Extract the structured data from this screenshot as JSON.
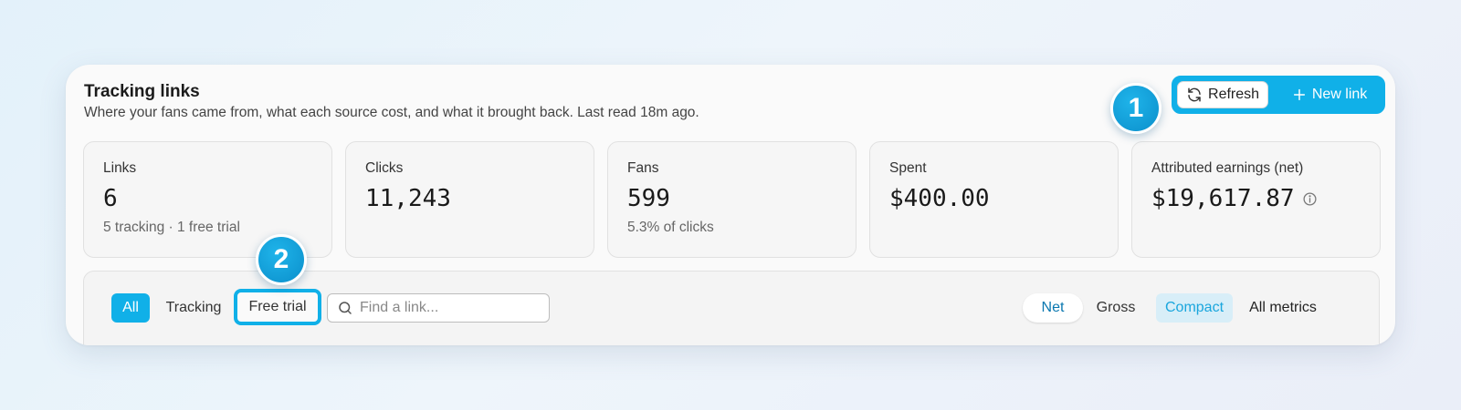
{
  "header": {
    "title": "Tracking links",
    "subtitle": "Where your fans came from, what each source cost, and what it brought back. Last read 18m ago."
  },
  "actions": {
    "refresh_label": "Refresh",
    "new_link_label": "New link"
  },
  "stats": [
    {
      "label": "Links",
      "value": "6",
      "sub": "5 tracking · 1 free trial"
    },
    {
      "label": "Clicks",
      "value": "11,243",
      "sub": ""
    },
    {
      "label": "Fans",
      "value": "599",
      "sub": "5.3% of clicks"
    },
    {
      "label": "Spent",
      "value": "$400.00",
      "sub": ""
    },
    {
      "label": "Attributed earnings (net)",
      "value": "$19,617.87",
      "sub": ""
    }
  ],
  "filters": {
    "all": "All",
    "tracking": "Tracking",
    "free_trial": "Free trial",
    "search_placeholder": "Find a link...",
    "net": "Net",
    "gross": "Gross",
    "compact": "Compact",
    "all_metrics": "All metrics"
  },
  "badges": {
    "one": "1",
    "two": "2"
  },
  "colors": {
    "accent": "#10b0e8",
    "accent_dark": "#0b78b0"
  }
}
